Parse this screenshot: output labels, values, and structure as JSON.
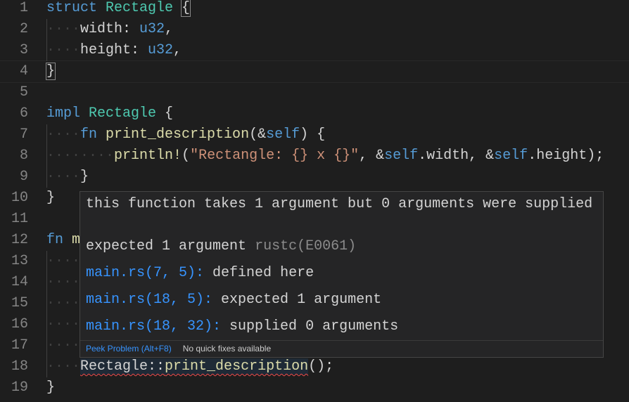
{
  "editor": {
    "lines": [
      {
        "n": "1",
        "tokens": [
          {
            "t": "struct ",
            "c": "k"
          },
          {
            "t": "Rectagle ",
            "c": "t"
          },
          {
            "t": "{",
            "c": "d bm"
          }
        ]
      },
      {
        "n": "2",
        "tokens": [
          {
            "t": "····",
            "c": "w"
          },
          {
            "t": "width: ",
            "c": "d"
          },
          {
            "t": "u32",
            "c": "k"
          },
          {
            "t": ",",
            "c": "d"
          }
        ]
      },
      {
        "n": "3",
        "tokens": [
          {
            "t": "····",
            "c": "w"
          },
          {
            "t": "height: ",
            "c": "d"
          },
          {
            "t": "u32",
            "c": "k"
          },
          {
            "t": ",",
            "c": "d"
          }
        ]
      },
      {
        "n": "4",
        "tokens": [
          {
            "t": "}",
            "c": "d bm"
          }
        ]
      },
      {
        "n": "5",
        "tokens": []
      },
      {
        "n": "6",
        "tokens": [
          {
            "t": "impl ",
            "c": "k"
          },
          {
            "t": "Rectagle ",
            "c": "t"
          },
          {
            "t": "{",
            "c": "d"
          }
        ]
      },
      {
        "n": "7",
        "tokens": [
          {
            "t": "····",
            "c": "w"
          },
          {
            "t": "fn ",
            "c": "k"
          },
          {
            "t": "print_description",
            "c": "f"
          },
          {
            "t": "(&",
            "c": "d"
          },
          {
            "t": "self",
            "c": "k"
          },
          {
            "t": ") {",
            "c": "d"
          }
        ]
      },
      {
        "n": "8",
        "tokens": [
          {
            "t": "····",
            "c": "w"
          },
          {
            "t": "····",
            "c": "w"
          },
          {
            "t": "println!",
            "c": "f"
          },
          {
            "t": "(",
            "c": "d"
          },
          {
            "t": "\"Rectangle: {} x {}\"",
            "c": "s"
          },
          {
            "t": ", &",
            "c": "d"
          },
          {
            "t": "self",
            "c": "k"
          },
          {
            "t": ".width, &",
            "c": "d"
          },
          {
            "t": "self",
            "c": "k"
          },
          {
            "t": ".height);",
            "c": "d"
          }
        ]
      },
      {
        "n": "9",
        "tokens": [
          {
            "t": "····",
            "c": "w"
          },
          {
            "t": "}",
            "c": "d"
          }
        ]
      },
      {
        "n": "10",
        "tokens": [
          {
            "t": "}",
            "c": "d"
          }
        ]
      },
      {
        "n": "11",
        "tokens": []
      },
      {
        "n": "12",
        "tokens": [
          {
            "t": "fn ",
            "c": "k"
          },
          {
            "t": "m",
            "c": "f"
          }
        ]
      },
      {
        "n": "13",
        "tokens": [
          {
            "t": "····",
            "c": "w"
          }
        ]
      },
      {
        "n": "14",
        "tokens": [
          {
            "t": "····",
            "c": "w"
          }
        ]
      },
      {
        "n": "15",
        "tokens": [
          {
            "t": "····",
            "c": "w"
          }
        ]
      },
      {
        "n": "16",
        "tokens": [
          {
            "t": "····",
            "c": "w"
          }
        ]
      },
      {
        "n": "17",
        "tokens": [
          {
            "t": "····",
            "c": "w"
          }
        ]
      },
      {
        "n": "18",
        "tokens": [
          {
            "t": "····",
            "c": "w"
          },
          {
            "t": "Rectagle::",
            "c": "d err"
          },
          {
            "t": "print_description",
            "c": "f err"
          },
          {
            "t": "();",
            "c": "d"
          }
        ]
      },
      {
        "n": "19",
        "tokens": [
          {
            "t": "}",
            "c": "d"
          }
        ]
      }
    ]
  },
  "hover": {
    "message": "this function takes 1 argument but 0 arguments were supplied",
    "detail": "expected 1 argument",
    "source": "rustc(E0061)",
    "related": [
      {
        "location": "main.rs(7, 5):",
        "text": "defined here"
      },
      {
        "location": "main.rs(18, 5):",
        "text": "expected 1 argument"
      },
      {
        "location": "main.rs(18, 32):",
        "text": "supplied 0 arguments"
      }
    ],
    "peek_label": "Peek Problem (Alt+F8)",
    "no_fixes_label": "No quick fixes available"
  }
}
